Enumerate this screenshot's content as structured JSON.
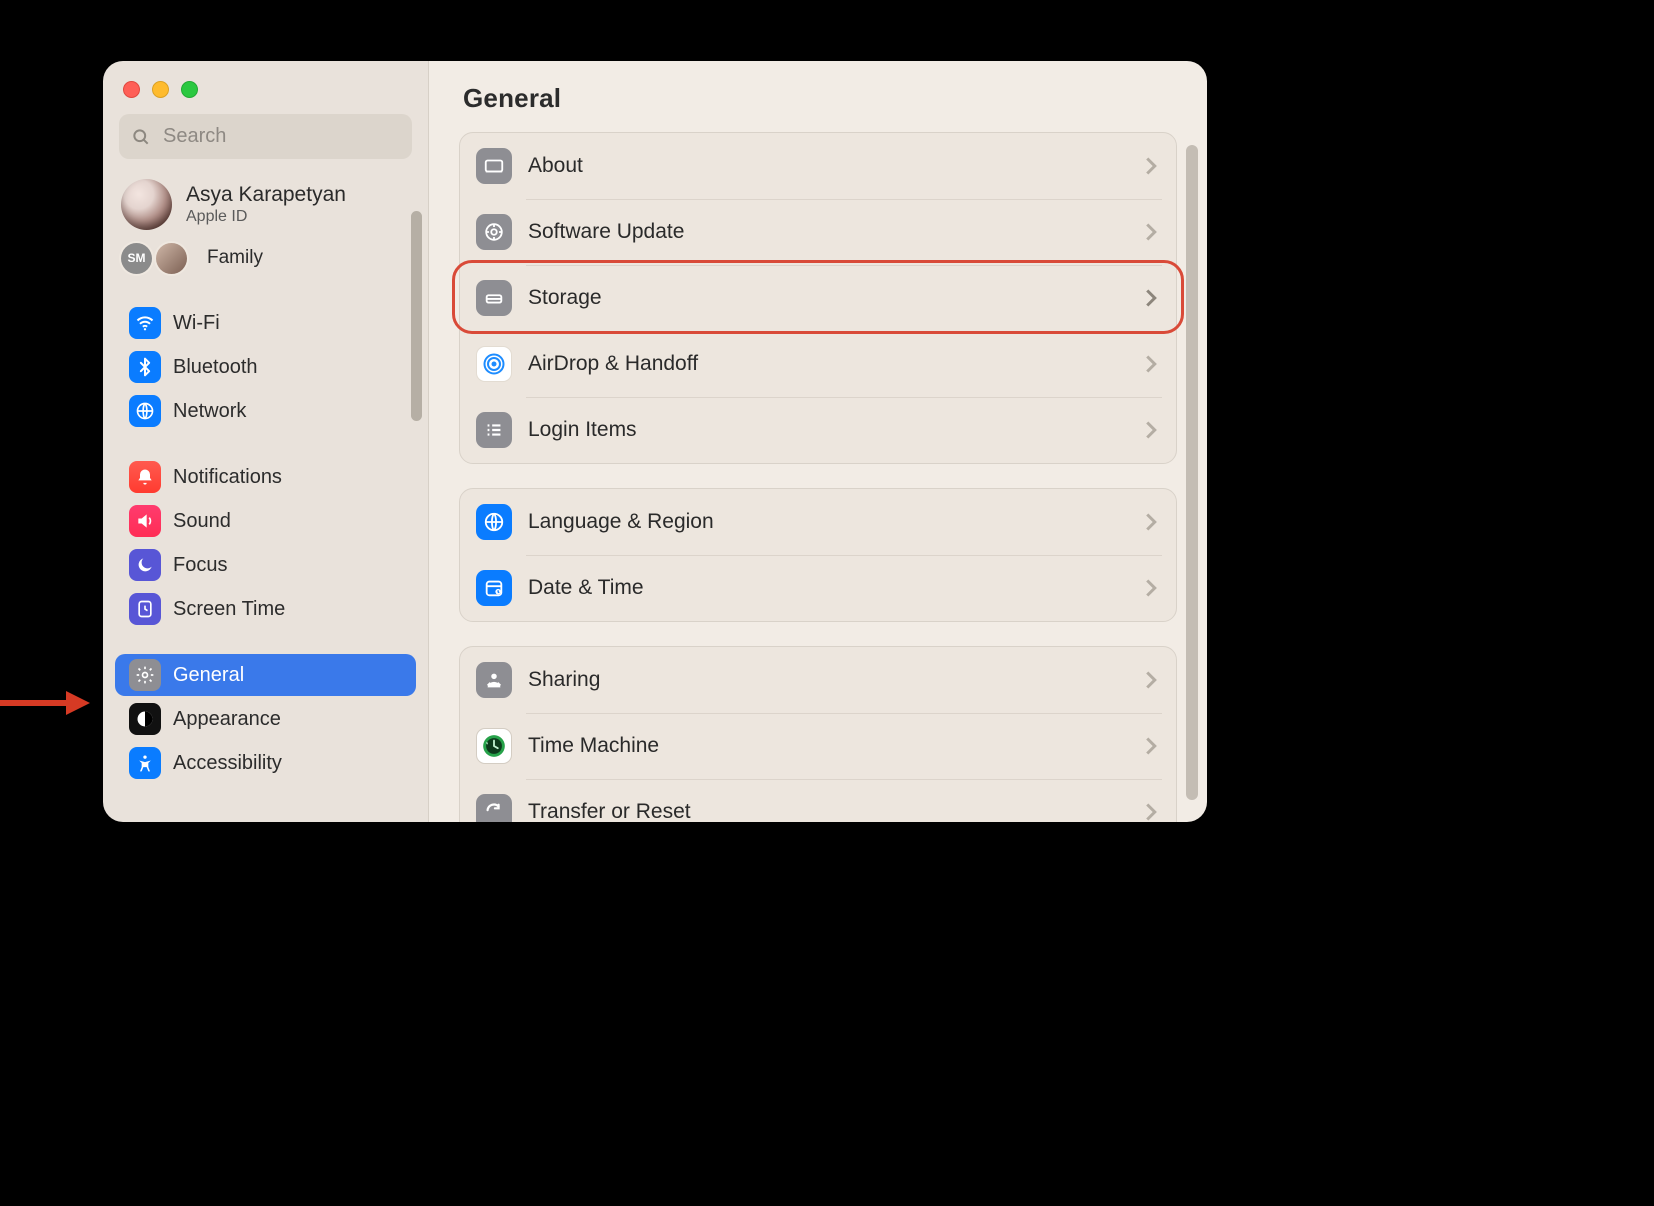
{
  "window_title": "General",
  "search": {
    "placeholder": "Search"
  },
  "account": {
    "name": "Asya Karapetyan",
    "sub": "Apple ID"
  },
  "family": {
    "label": "Family",
    "badge_text": "SM"
  },
  "sidebar": {
    "sections": [
      {
        "items": [
          {
            "label": "Wi-Fi",
            "icon": "wifi"
          },
          {
            "label": "Bluetooth",
            "icon": "bt"
          },
          {
            "label": "Network",
            "icon": "net"
          }
        ]
      },
      {
        "items": [
          {
            "label": "Notifications",
            "icon": "notif"
          },
          {
            "label": "Sound",
            "icon": "sound"
          },
          {
            "label": "Focus",
            "icon": "focus"
          },
          {
            "label": "Screen Time",
            "icon": "stime"
          }
        ]
      },
      {
        "items": [
          {
            "label": "General",
            "icon": "general",
            "selected": true
          },
          {
            "label": "Appearance",
            "icon": "appearance"
          },
          {
            "label": "Accessibility",
            "icon": "access"
          }
        ]
      }
    ]
  },
  "groups": [
    {
      "rows": [
        {
          "label": "About",
          "icon": "about"
        },
        {
          "label": "Software Update",
          "icon": "update"
        },
        {
          "label": "Storage",
          "icon": "storage",
          "highlight": true
        },
        {
          "label": "AirDrop & Handoff",
          "icon": "airdrop"
        },
        {
          "label": "Login Items",
          "icon": "login"
        }
      ]
    },
    {
      "rows": [
        {
          "label": "Language & Region",
          "icon": "lang"
        },
        {
          "label": "Date & Time",
          "icon": "date"
        }
      ]
    },
    {
      "rows": [
        {
          "label": "Sharing",
          "icon": "sharing"
        },
        {
          "label": "Time Machine",
          "icon": "tm"
        },
        {
          "label": "Transfer or Reset",
          "icon": "transfer"
        }
      ]
    }
  ],
  "annotations": {
    "pointer_arrow_target": "General",
    "ring_target": "Storage"
  }
}
